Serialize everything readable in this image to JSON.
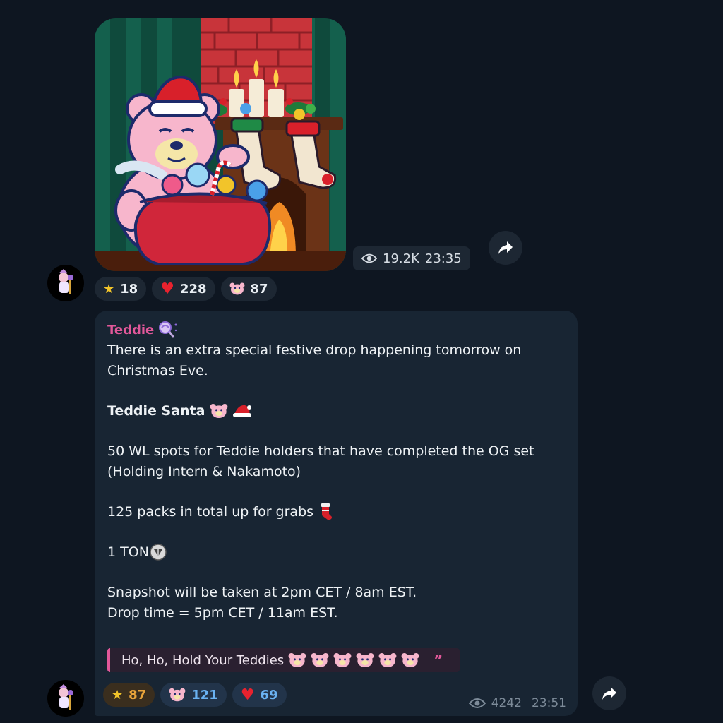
{
  "post1": {
    "sticker_icon": "teddie-santa-sticker",
    "views": "19.2K",
    "time": "23:35",
    "reactions": [
      {
        "icon": "star-icon",
        "count": "18"
      },
      {
        "icon": "heart-icon",
        "count": "228"
      },
      {
        "icon": "teddy-bear-icon",
        "count": "87"
      }
    ]
  },
  "post2": {
    "sender": "Teddie",
    "lines": {
      "intro1": "There is an extra special festive drop happening tomorrow on",
      "intro2": "Christmas Eve.",
      "title": "Teddie Santa",
      "wl1": "50 WL spots for Teddie holders that have completed the OG set",
      "wl2": "(Holding Intern & Nakamoto)",
      "packs": "125 packs in total up for grabs",
      "price": "1 TON",
      "snapshot": "Snapshot will be taken at 2pm CET / 8am EST.",
      "drop": "Drop time = 5pm CET / 11am EST."
    },
    "quote": "Ho, Ho, Hold Your Teddies",
    "reactions": [
      {
        "icon": "star-icon",
        "count": "87"
      },
      {
        "icon": "teddy-bear-icon",
        "count": "121"
      },
      {
        "icon": "heart-icon",
        "count": "69"
      }
    ],
    "views": "4242",
    "time": "23:51"
  },
  "colors": {
    "background": "#0e1621",
    "bubble": "#182533",
    "sender": "#e2589a",
    "star_count": "#e8a33a",
    "bear_count": "#6ab2f2"
  }
}
